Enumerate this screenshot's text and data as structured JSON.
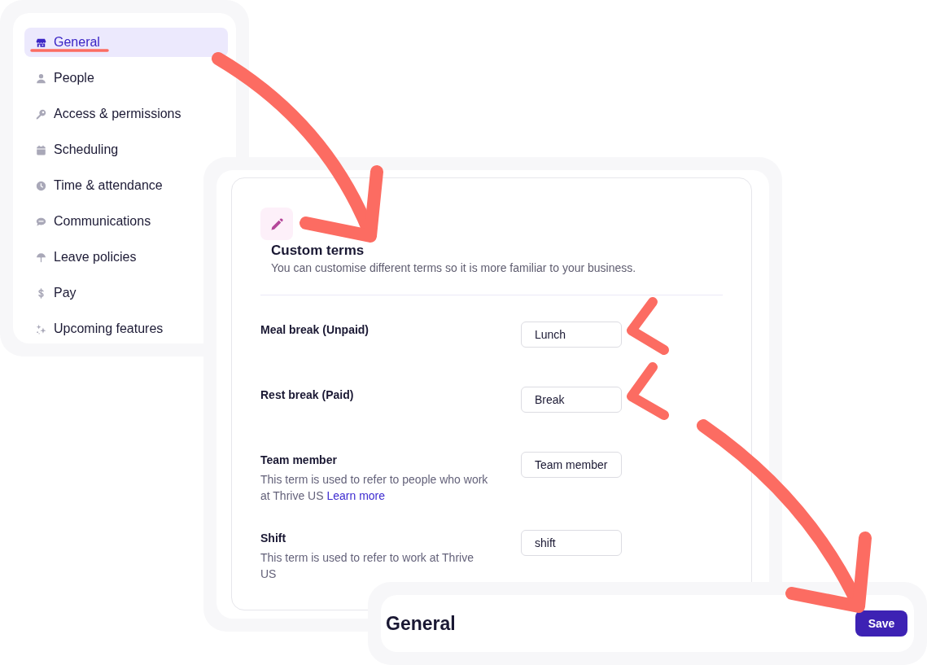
{
  "sidebar": {
    "items": [
      {
        "label": "General",
        "selected": true
      },
      {
        "label": "People",
        "selected": false
      },
      {
        "label": "Access & permissions",
        "selected": false
      },
      {
        "label": "Scheduling",
        "selected": false
      },
      {
        "label": "Time & attendance",
        "selected": false
      },
      {
        "label": "Communications",
        "selected": false
      },
      {
        "label": "Leave policies",
        "selected": false
      },
      {
        "label": "Pay",
        "selected": false
      },
      {
        "label": "Upcoming features",
        "selected": false
      }
    ]
  },
  "custom_terms": {
    "title": "Custom terms",
    "description": "You can customise different terms so it is more familiar to your business.",
    "fields": [
      {
        "label": "Meal break (Unpaid)",
        "value": "Lunch"
      },
      {
        "label": "Rest break (Paid)",
        "value": "Break"
      },
      {
        "label": "Team member",
        "description": "This term is used to refer to people who work at Thrive US",
        "link": "Learn more",
        "value": "Team member"
      },
      {
        "label": "Shift",
        "description": "This term is used to refer to work at Thrive US",
        "value": "shift"
      }
    ]
  },
  "footer": {
    "title": "General",
    "save_button": "Save"
  }
}
